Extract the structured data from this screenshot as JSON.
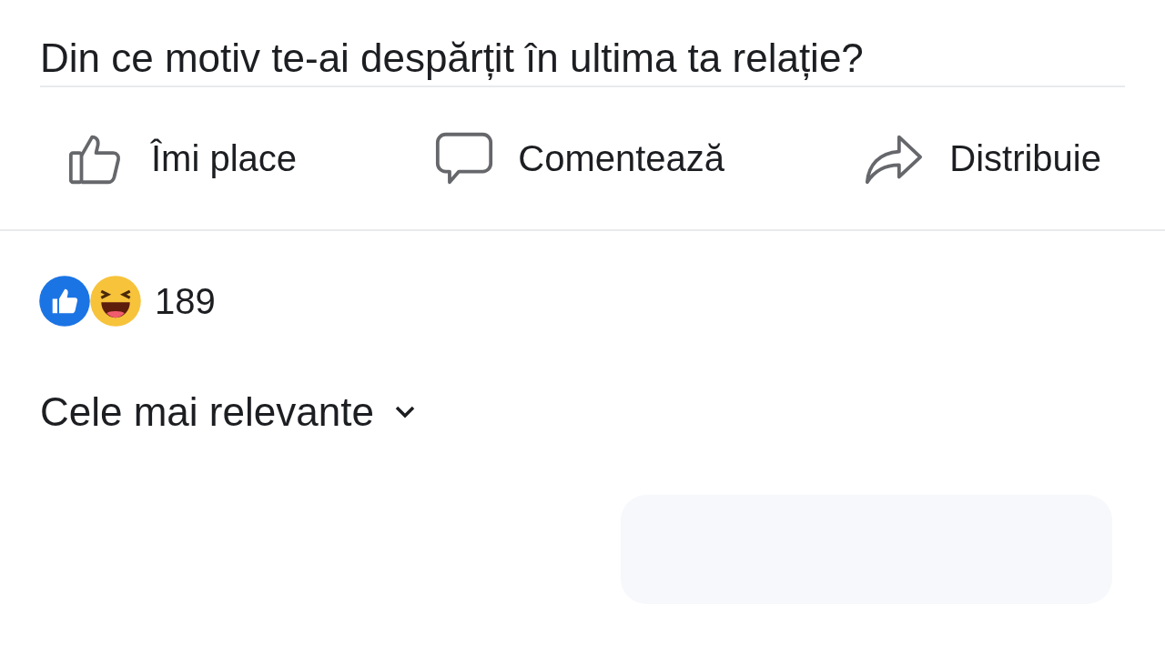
{
  "post": {
    "text": "Din ce motiv te-ai despărțit în ultima ta relație?"
  },
  "actions": [
    {
      "kind": "like",
      "label": "Îmi place"
    },
    {
      "kind": "comment",
      "label": "Comentează"
    },
    {
      "kind": "share",
      "label": "Distribuie"
    }
  ],
  "reactions": {
    "count": "189"
  },
  "comments": {
    "sort": "Cele mai relevante"
  }
}
